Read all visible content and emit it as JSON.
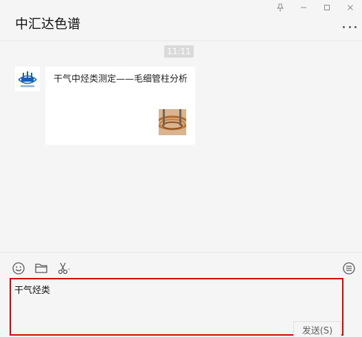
{
  "window": {
    "title": "中汇达色谱"
  },
  "chat": {
    "timestamp": "11:11",
    "message": {
      "title": "干气中烃类测定——毛细管柱分析"
    }
  },
  "composer": {
    "text": "干气烃类",
    "send_label": "发送(S)"
  },
  "colors": {
    "highlight_border": "#d40000",
    "background": "#f5f5f5",
    "avatar_blue": "#1a5fb4"
  },
  "icons": {
    "emoji": "emoji-icon",
    "folder": "folder-icon",
    "scissors": "scissors-icon",
    "history": "chat-history-icon",
    "more": "more-icon"
  }
}
